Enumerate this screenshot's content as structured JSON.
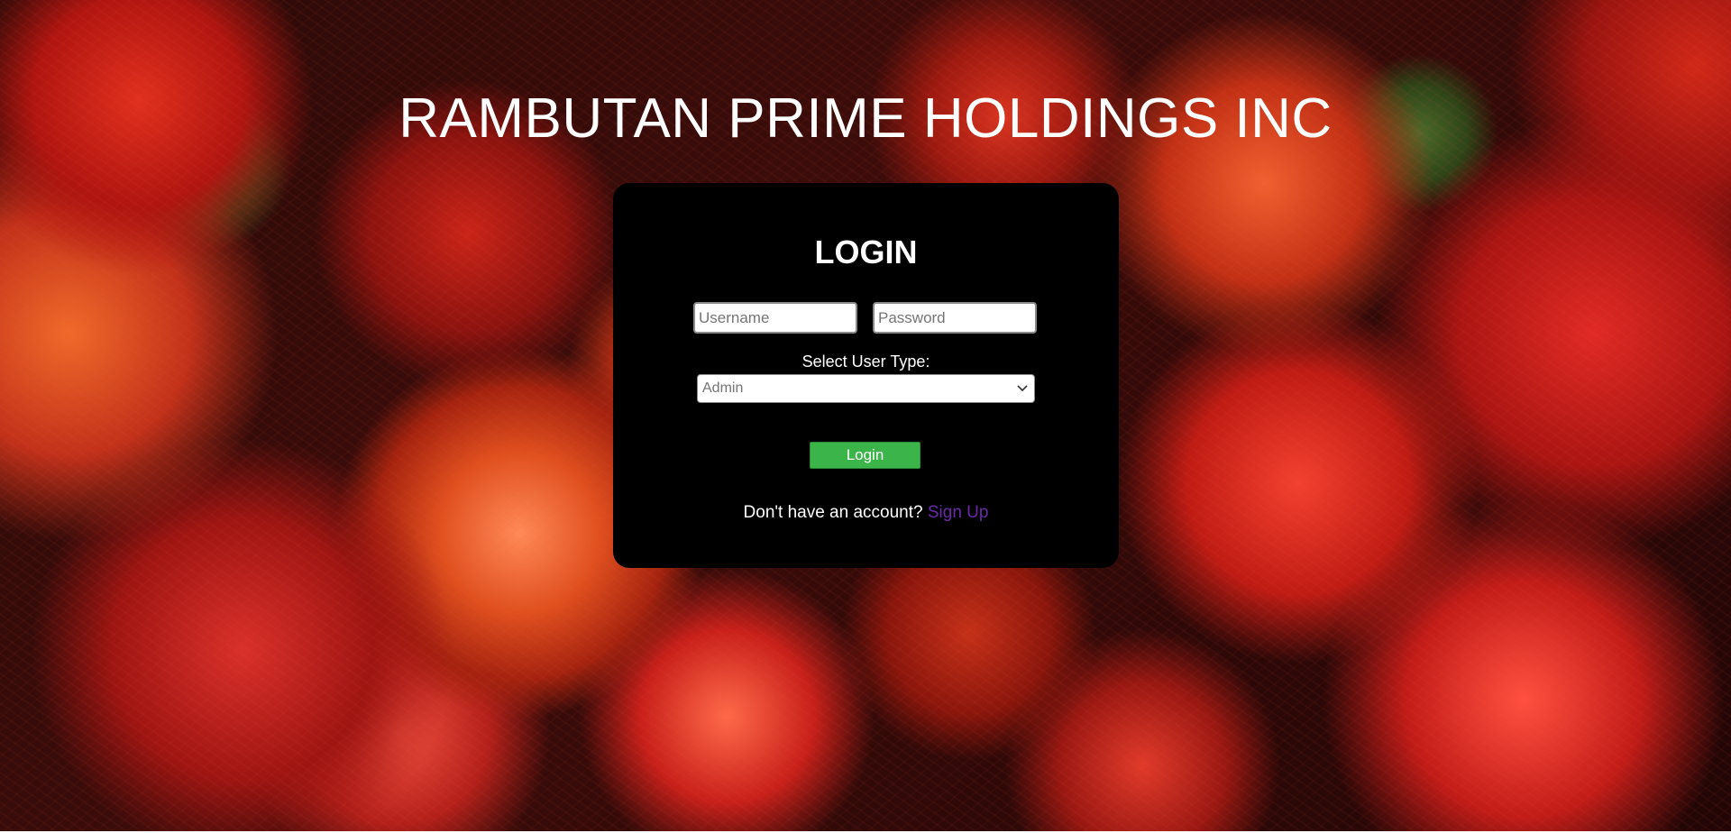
{
  "header": {
    "company_name": "RAMBUTAN PRIME HOLDINGS INC"
  },
  "login_form": {
    "heading": "LOGIN",
    "username_placeholder": "Username",
    "password_placeholder": "Password",
    "user_type_label": "Select User Type:",
    "user_type_selected": "Admin",
    "login_button_label": "Login",
    "signup_prompt": "Don't have an account?",
    "signup_link_label": "Sign Up"
  },
  "colors": {
    "card_background": "#000000",
    "login_button": "#3bb54a",
    "signup_link": "#6a2aa8",
    "title_text": "#ffffff"
  },
  "icons": {
    "select_arrow": "chevron-down-icon"
  }
}
